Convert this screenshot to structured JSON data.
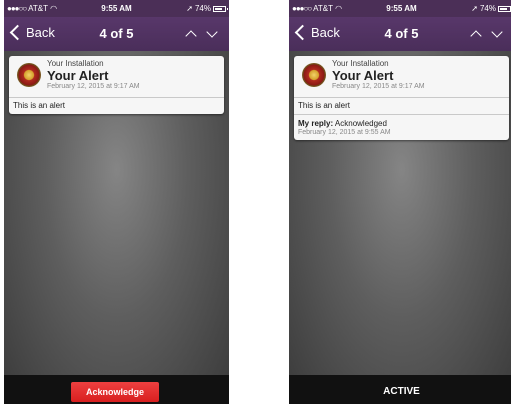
{
  "status_bar": {
    "carrier": "AT&T",
    "time": "9:55 AM",
    "battery": "74%",
    "battery_level": 0.74
  },
  "nav": {
    "back_label": "Back",
    "position": "4 of 5"
  },
  "alert": {
    "source": "Your Installation",
    "title": "Your Alert",
    "date": "February 12, 2015 at 9:17 AM",
    "body": "This is an alert"
  },
  "left_screen": {
    "button_label": "Acknowledge"
  },
  "right_screen": {
    "reply_label": "My reply:",
    "reply_text": "Acknowledged",
    "reply_date": "February 12, 2015 at 9:55 AM",
    "status_label": "ACTIVE"
  },
  "colors": {
    "nav_purple": "#4b2f57",
    "acknowledge_red": "#e02b2b"
  }
}
